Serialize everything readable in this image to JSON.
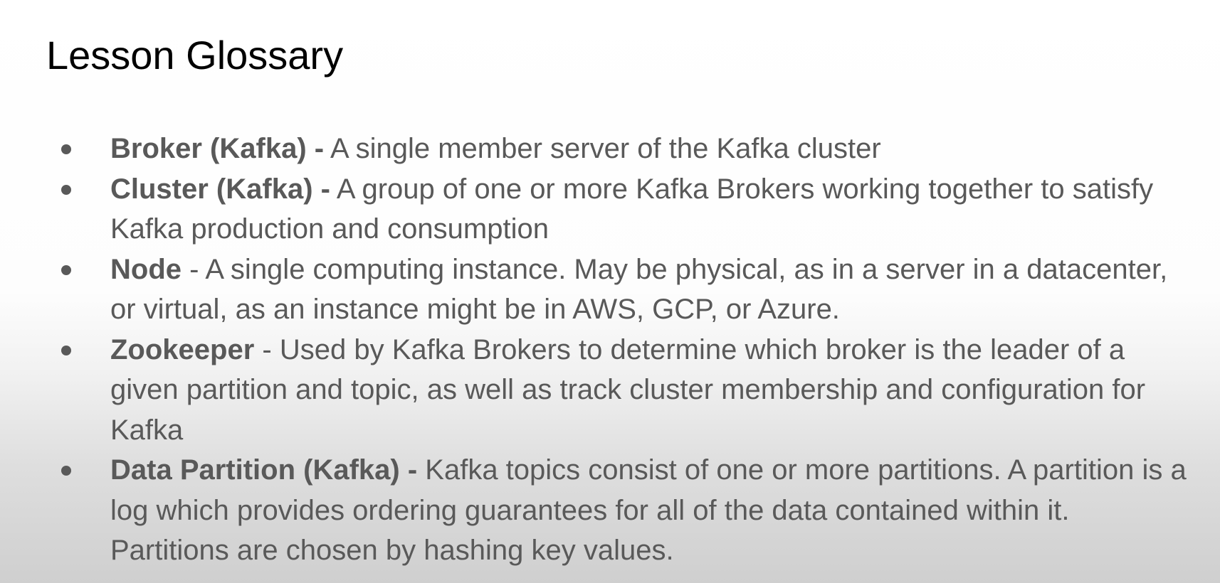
{
  "title": "Lesson Glossary",
  "entries": [
    {
      "term": "Broker (Kafka) -",
      "definition": " A single member server of the Kafka cluster"
    },
    {
      "term": "Cluster (Kafka) -",
      "definition": " A group of one or more Kafka Brokers working together to satisfy Kafka production and consumption"
    },
    {
      "term": "Node",
      "definition": " - A single computing instance. May be physical, as in a server in a datacenter, or virtual, as an instance might be in AWS, GCP, or Azure."
    },
    {
      "term": "Zookeeper",
      "definition": " - Used by Kafka Brokers to determine which broker is the leader of a given partition and topic, as well as track cluster membership and configuration for Kafka"
    },
    {
      "term": "Data Partition (Kafka) -",
      "definition": " Kafka topics consist of one or more partitions. A partition is a log which provides ordering guarantees for all of the data contained within it. Partitions are chosen by hashing key values."
    }
  ],
  "colors": {
    "title": "#000000",
    "body_text": "#595959",
    "background_top": "#ffffff",
    "background_bottom": "#cfcfcf"
  }
}
